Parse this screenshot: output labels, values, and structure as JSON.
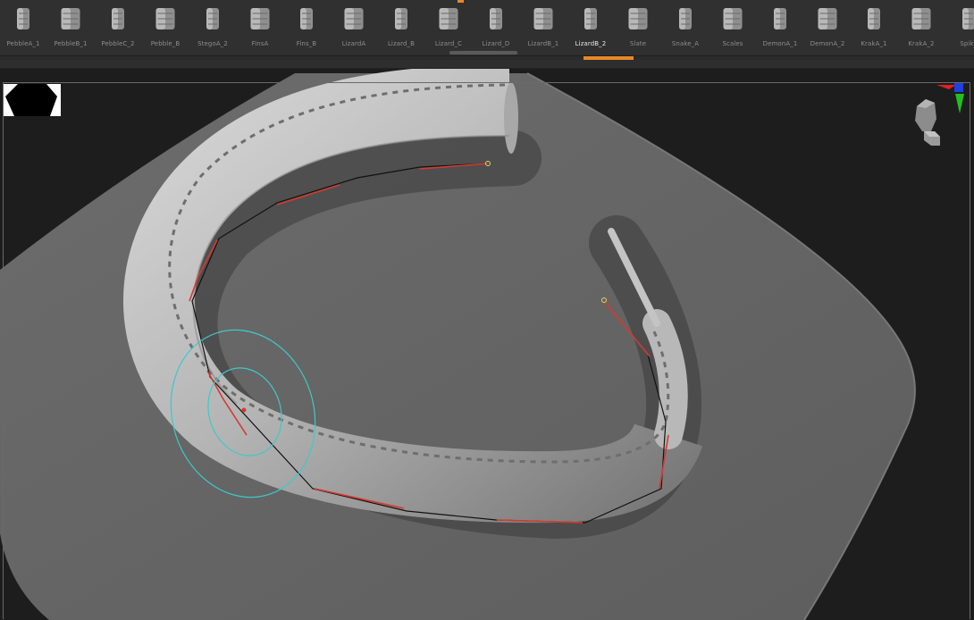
{
  "brush_shelf": {
    "selected": "LizardB_2",
    "items": [
      {
        "label": "PebbleA_1",
        "icon": "brush-pebble-icon"
      },
      {
        "label": "PebbleB_1",
        "icon": "brush-pebble-icon"
      },
      {
        "label": "PebbleC_2",
        "icon": "brush-pebble-icon"
      },
      {
        "label": "Pebble_B",
        "icon": "brush-pebble-icon"
      },
      {
        "label": "StegoA_2",
        "icon": "brush-stego-icon"
      },
      {
        "label": "FinsA",
        "icon": "brush-fin-icon"
      },
      {
        "label": "Fins_B",
        "icon": "brush-fin-icon"
      },
      {
        "label": "LizardA",
        "icon": "brush-lizard-icon"
      },
      {
        "label": "Lizard_B",
        "icon": "brush-lizard-icon"
      },
      {
        "label": "Lizard_C",
        "icon": "brush-lizard-icon"
      },
      {
        "label": "Lizard_D",
        "icon": "brush-lizard-icon"
      },
      {
        "label": "LizardB_1",
        "icon": "brush-lizard-icon"
      },
      {
        "label": "LizardB_2",
        "icon": "brush-lizard-icon"
      },
      {
        "label": "Slate",
        "icon": "brush-slate-icon"
      },
      {
        "label": "Snake_A",
        "icon": "brush-snake-icon"
      },
      {
        "label": "Scales",
        "icon": "brush-scales-icon"
      },
      {
        "label": "DemonA_1",
        "icon": "brush-demon-icon"
      },
      {
        "label": "DemonA_2",
        "icon": "brush-demon-icon"
      },
      {
        "label": "KrakA_1",
        "icon": "brush-krak-icon"
      },
      {
        "label": "KrakA_2",
        "icon": "brush-krak-icon"
      },
      {
        "label": "Spiky",
        "icon": "brush-spiky-icon"
      }
    ]
  },
  "viewport": {
    "alpha_icon": "alpha-octagon-icon",
    "gizmo_icon": "navigation-head-gizmo-icon",
    "colors": {
      "background": "#1d1d1d",
      "plane": "#646464",
      "tube": "#bdbdbd",
      "curve_active": "#d43a30",
      "curve_inactive": "#111111",
      "brush_ring": "#3fc8c8",
      "axis_x": "#e02020",
      "axis_y": "#20c020",
      "axis_z": "#2040e0"
    }
  }
}
